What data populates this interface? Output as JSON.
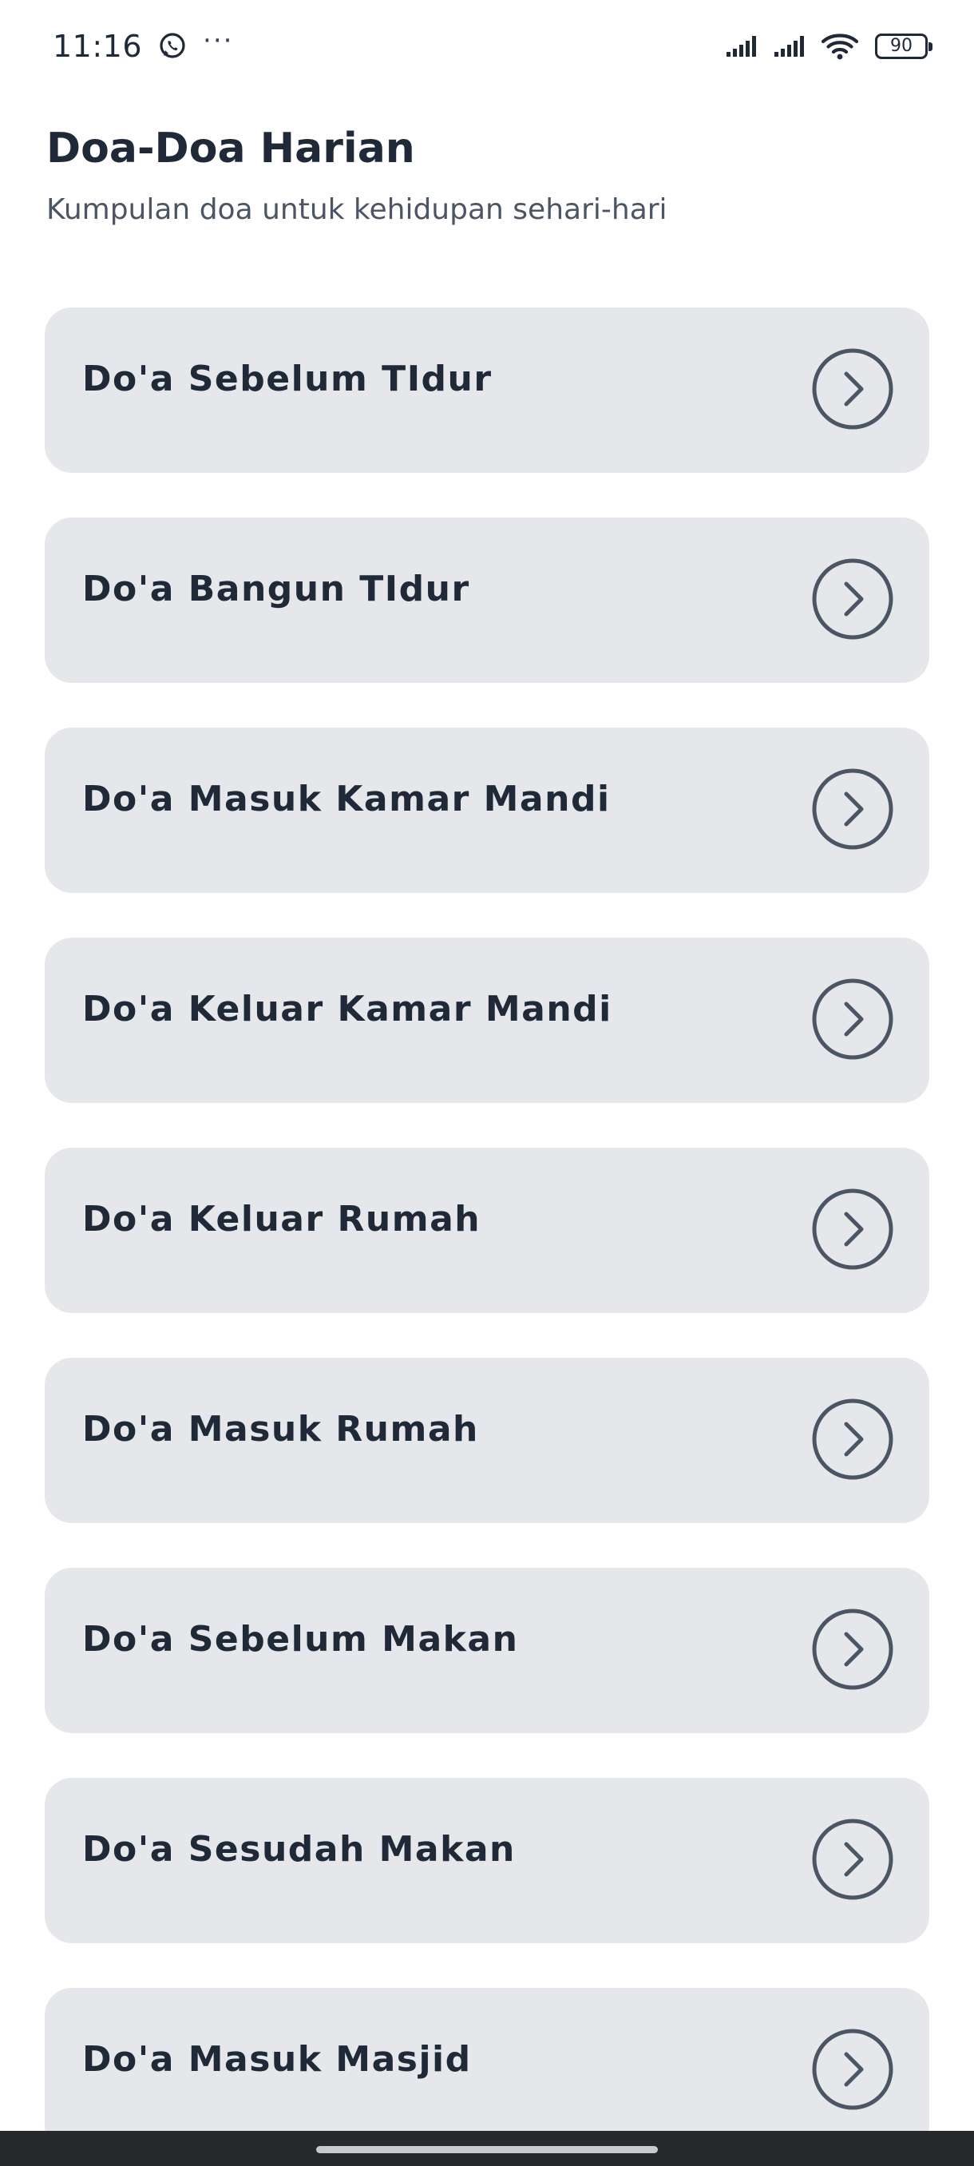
{
  "status_bar": {
    "time": "11:16",
    "notification_icons": [
      "whatsapp-icon",
      "more-dots-icon"
    ],
    "more_indicator": "···",
    "battery_level": "90",
    "system_icons": [
      "signal-icon",
      "signal-icon",
      "wifi-icon",
      "battery-icon"
    ]
  },
  "header": {
    "title": "Doa-Doa Harian",
    "subtitle": "Kumpulan doa untuk kehidupan sehari-hari"
  },
  "doa_list": {
    "items": [
      {
        "label": "Do'a Sebelum TIdur"
      },
      {
        "label": "Do'a Bangun TIdur"
      },
      {
        "label": "Do'a Masuk Kamar Mandi"
      },
      {
        "label": "Do'a Keluar Kamar Mandi"
      },
      {
        "label": "Do'a Keluar Rumah"
      },
      {
        "label": "Do'a Masuk Rumah"
      },
      {
        "label": "Do'a Sebelum Makan"
      },
      {
        "label": "Do'a Sesudah Makan"
      },
      {
        "label": "Do'a Masuk Masjid"
      }
    ],
    "item_icon": "chevron-right-circle-icon"
  },
  "colors": {
    "background": "#ffffff",
    "card": "#e5e7eb",
    "text_primary": "#1f2937",
    "text_secondary": "#4b5563",
    "icon": "#4b5563",
    "nav_bar": "#27292d"
  }
}
